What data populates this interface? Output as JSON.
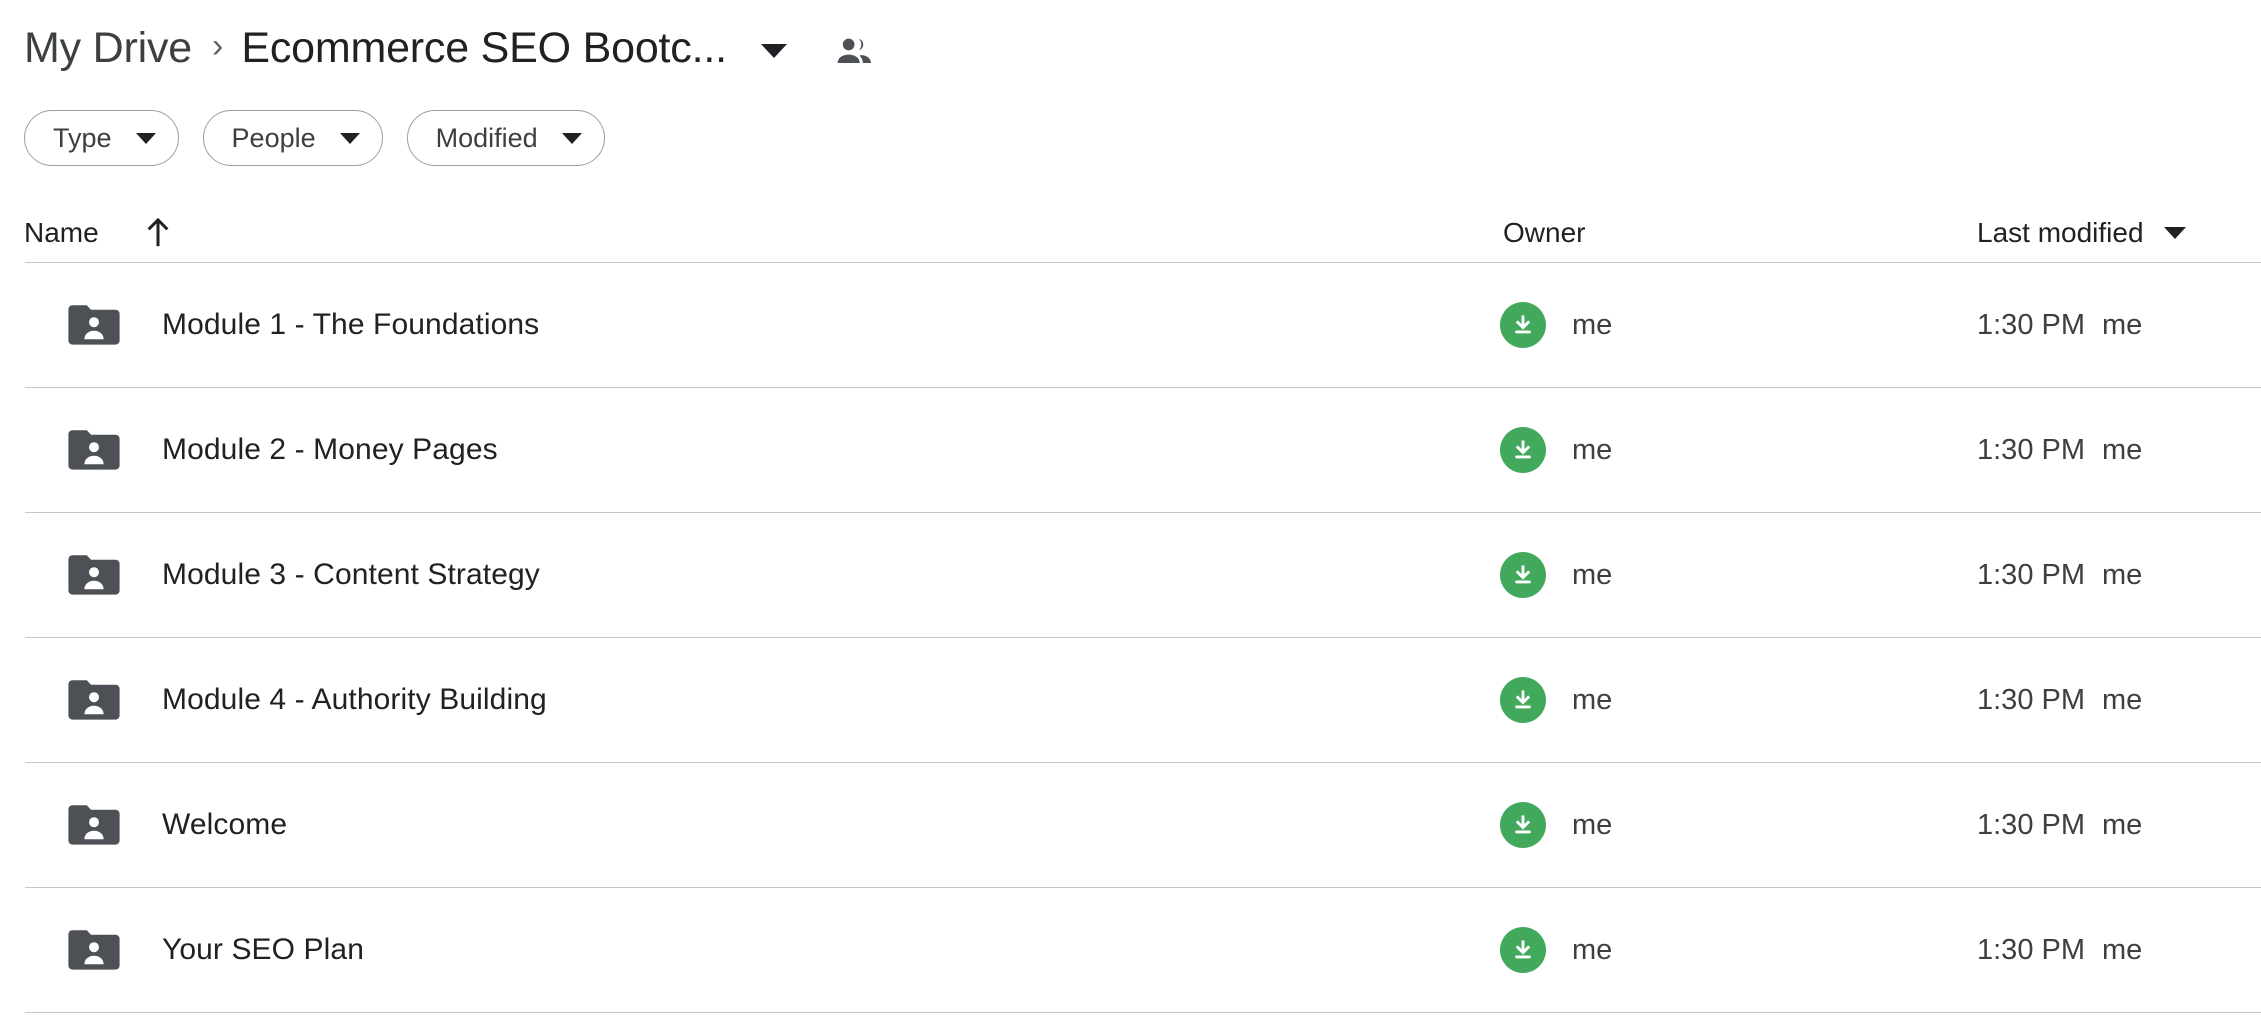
{
  "breadcrumb": {
    "root_label": "My Drive",
    "separator": "›",
    "current_label": "Ecommerce SEO Bootc...",
    "caret_icon": "chevron-down-icon",
    "shared_icon": "people-icon"
  },
  "filters": {
    "chips": [
      {
        "label": "Type",
        "caret_icon": "chevron-down-icon"
      },
      {
        "label": "People",
        "caret_icon": "chevron-down-icon"
      },
      {
        "label": "Modified",
        "caret_icon": "chevron-down-icon"
      }
    ]
  },
  "table": {
    "columns": {
      "name": "Name",
      "name_sort_icon": "arrow-up-icon",
      "owner": "Owner",
      "modified": "Last modified",
      "modified_caret_icon": "chevron-down-icon"
    },
    "rows": [
      {
        "icon": "shared-folder-icon",
        "name": "Module 1 - The Foundations",
        "owner_avatar_icon": "download-arrow-icon",
        "owner": "me",
        "modified_time": "1:30 PM",
        "modified_by": "me"
      },
      {
        "icon": "shared-folder-icon",
        "name": "Module 2 - Money Pages",
        "owner_avatar_icon": "download-arrow-icon",
        "owner": "me",
        "modified_time": "1:30 PM",
        "modified_by": "me"
      },
      {
        "icon": "shared-folder-icon",
        "name": "Module 3 - Content Strategy",
        "owner_avatar_icon": "download-arrow-icon",
        "owner": "me",
        "modified_time": "1:30 PM",
        "modified_by": "me"
      },
      {
        "icon": "shared-folder-icon",
        "name": "Module 4 - Authority Building",
        "owner_avatar_icon": "download-arrow-icon",
        "owner": "me",
        "modified_time": "1:30 PM",
        "modified_by": "me"
      },
      {
        "icon": "shared-folder-icon",
        "name": "Welcome",
        "owner_avatar_icon": "download-arrow-icon",
        "owner": "me",
        "modified_time": "1:30 PM",
        "modified_by": "me"
      },
      {
        "icon": "shared-folder-icon",
        "name": "Your SEO Plan",
        "owner_avatar_icon": "download-arrow-icon",
        "owner": "me",
        "modified_time": "1:30 PM",
        "modified_by": "me"
      }
    ]
  },
  "colors": {
    "avatar_green": "#41a85c",
    "folder_gray": "#4d5156",
    "text_primary": "#202124",
    "text_secondary": "#3c4043",
    "divider": "#c4c7c5",
    "chip_border": "#9aa0a6",
    "background": "#ffffff"
  }
}
